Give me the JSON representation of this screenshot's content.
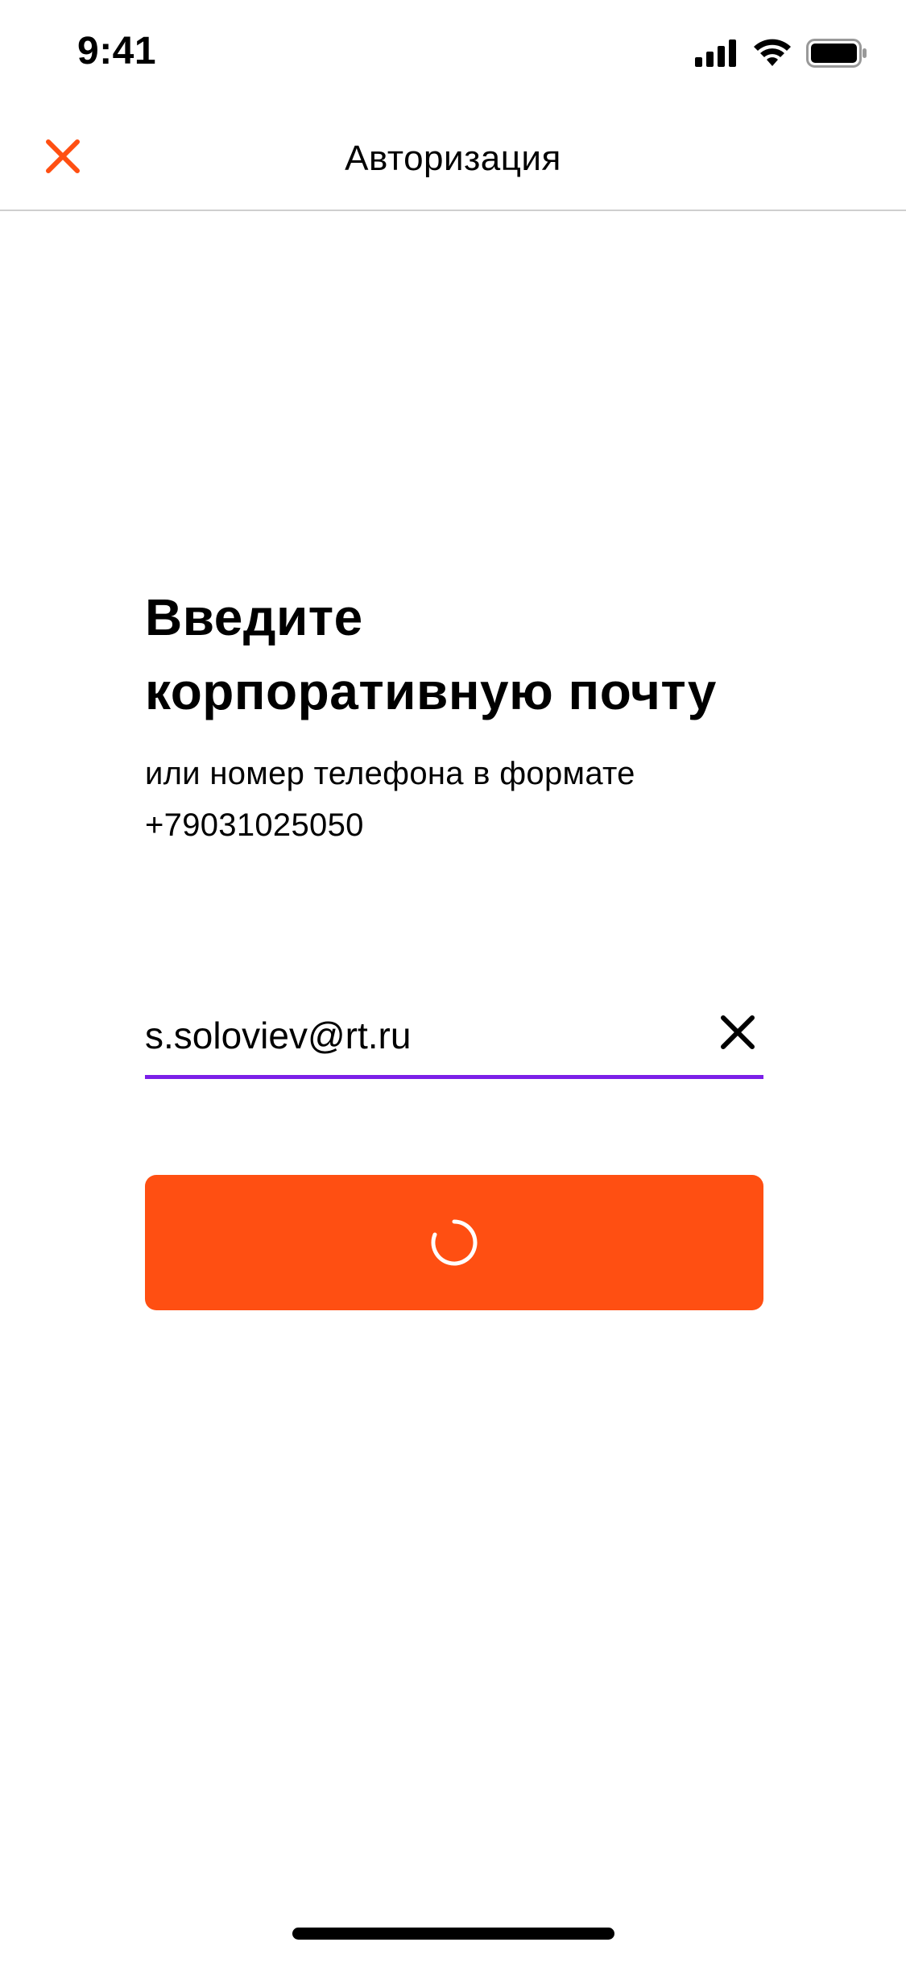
{
  "status_bar": {
    "time": "9:41",
    "icons": [
      "cellular-signal-icon",
      "wifi-icon",
      "battery-icon"
    ]
  },
  "nav": {
    "title": "Авторизация",
    "close_icon": "close-icon",
    "accent_color": "#ff4f12"
  },
  "content": {
    "heading_line1": "Введите",
    "heading_line2": "корпоративную почту",
    "subtext_line1": "или номер телефона в формате",
    "subtext_line2": "+79031025050"
  },
  "login_field": {
    "value": "s.soloviev@rt.ru",
    "clear_icon": "clear-icon",
    "underline_color": "#7b1fe8"
  },
  "submit_button": {
    "state": "loading",
    "spinner_icon": "loading-spinner-icon",
    "color": "#ff4f12"
  }
}
